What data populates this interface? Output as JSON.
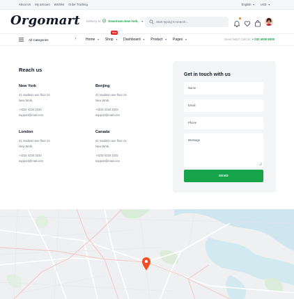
{
  "topbar": {
    "links": [
      "About Us",
      "My account",
      "Wishlist",
      "Order Tracking"
    ],
    "language": "English",
    "currency": "USD"
  },
  "header": {
    "logo": "Orgomart",
    "deliver_label": "Delivery to",
    "deliver_location": "Downtown New York,",
    "search_placeholder": "Start typing to search..."
  },
  "nav": {
    "all_categories": "All Categories",
    "items": [
      {
        "label": "Home"
      },
      {
        "label": "Shop"
      },
      {
        "label": "Dashboard"
      },
      {
        "label": "Product"
      },
      {
        "label": "Pages"
      }
    ],
    "new_badge": "New",
    "help_label": "Need help? Call Us:",
    "help_phone": "+ 032 4000 8000"
  },
  "reach": {
    "title": "Reach us",
    "offices": [
      {
        "city": "New York",
        "address1": "41 madison ave floor 24",
        "address2": "New Work,",
        "phone": "+4232 4234 3232",
        "email": "support@mail.com"
      },
      {
        "city": "Benjing",
        "address1": "41 madison ave floor 24",
        "address2": "New Work,",
        "phone": "+4232 4234 3232",
        "email": "support@mail.com"
      },
      {
        "city": "London",
        "address1": "41 madison ave floor 24",
        "address2": "New Work,",
        "phone": "+4232 4234 3232",
        "email": "support@mail.com"
      },
      {
        "city": "Canada",
        "address1": "41 madison ave floor 24",
        "address2": "New Work,",
        "phone": "+4232 4234 3232",
        "email": "support@mail.com"
      }
    ]
  },
  "form": {
    "title": "Get in touch with us",
    "name_placeholder": "Name",
    "email_placeholder": "Email",
    "phone_placeholder": "Phone",
    "message_placeholder": "Message",
    "send_label": "SEND"
  },
  "colors": {
    "accent": "#16a34a",
    "badge": "#dc2626",
    "map_pin": "#f04e23"
  }
}
